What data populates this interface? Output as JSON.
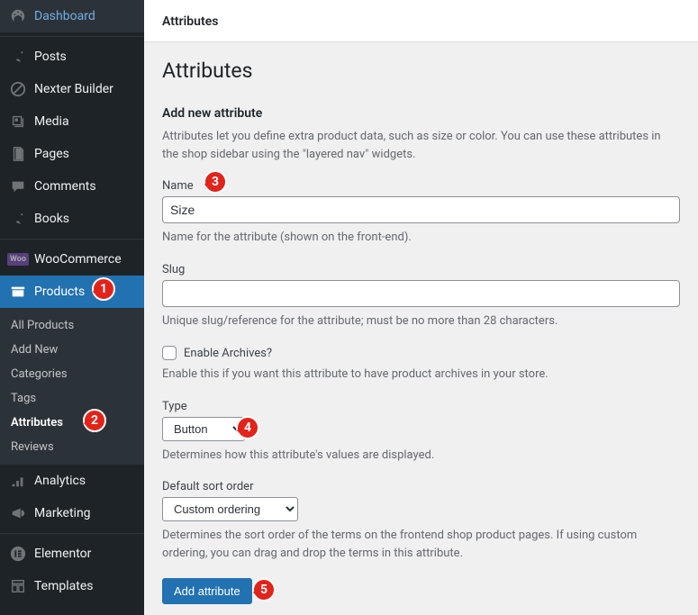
{
  "sidebar": {
    "items": [
      {
        "label": "Dashboard",
        "icon": "dashboard"
      },
      {
        "label": "Posts",
        "icon": "pin"
      },
      {
        "label": "Nexter Builder",
        "icon": "circle-slash"
      },
      {
        "label": "Media",
        "icon": "media"
      },
      {
        "label": "Pages",
        "icon": "pages"
      },
      {
        "label": "Comments",
        "icon": "comments"
      },
      {
        "label": "Books",
        "icon": "pin"
      },
      {
        "label": "WooCommerce",
        "icon": "woo"
      },
      {
        "label": "Products",
        "icon": "archive",
        "active": true
      },
      {
        "label": "Analytics",
        "icon": "analytics"
      },
      {
        "label": "Marketing",
        "icon": "megaphone"
      },
      {
        "label": "Elementor",
        "icon": "elementor"
      },
      {
        "label": "Templates",
        "icon": "templates"
      }
    ],
    "submenu": [
      "All Products",
      "Add New",
      "Categories",
      "Tags",
      "Attributes",
      "Reviews"
    ],
    "submenu_current": "Attributes"
  },
  "topbar": {
    "tab": "Attributes"
  },
  "page": {
    "title": "Attributes",
    "section_heading": "Add new attribute",
    "intro": "Attributes let you define extra product data, such as size or color. You can use these attributes in the shop sidebar using the \"layered nav\" widgets.",
    "name_label": "Name",
    "name_value": "Size",
    "name_help": "Name for the attribute (shown on the front-end).",
    "slug_label": "Slug",
    "slug_value": "",
    "slug_help": "Unique slug/reference for the attribute; must be no more than 28 characters.",
    "archives_label": "Enable Archives?",
    "archives_help": "Enable this if you want this attribute to have product archives in your store.",
    "type_label": "Type",
    "type_value": "Button",
    "type_help": "Determines how this attribute's values are displayed.",
    "sort_label": "Default sort order",
    "sort_value": "Custom ordering",
    "sort_help": "Determines the sort order of the terms on the frontend shop product pages. If using custom ordering, you can drag and drop the terms in this attribute.",
    "submit_label": "Add attribute"
  },
  "annotations": {
    "b1": "1",
    "b2": "2",
    "b3": "3",
    "b4": "4",
    "b5": "5"
  }
}
